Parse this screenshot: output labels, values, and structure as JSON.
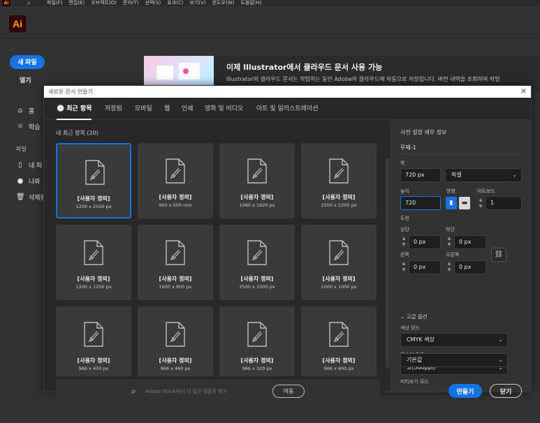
{
  "menubar": {
    "logo": "Ai",
    "items": [
      "파일(F)",
      "편집(E)",
      "오브젝트(O)",
      "문자(T)",
      "선택(S)",
      "효과(C)",
      "보기(V)",
      "윈도우(W)",
      "도움말(H)"
    ]
  },
  "header": {
    "logo": "Ai"
  },
  "home": {
    "new_file": "새 파일",
    "open": "열기",
    "home": "홈",
    "learn": "학습",
    "files_head": "파일",
    "my_files": "내 파",
    "shared": "나와",
    "deleted": "삭제됨"
  },
  "banner": {
    "title": "이제 Illustrator에서 클라우드 문서 사용 가능",
    "subtitle": "Illustrator의 클라우드 문서는 작업하는 동안 Adobe의 클라우드에 자동으로 저장됩니다. 버전 내역을 조회하여 작업"
  },
  "dialog": {
    "title": "새로운 문서 만들기",
    "tabs": [
      "최근 항목",
      "저장됨",
      "모바일",
      "웹",
      "인쇄",
      "영화 및 비디오",
      "아트 및 일러스트레이션"
    ],
    "recent_heading": "내 최근 항목 (20)",
    "presets": [
      {
        "label": "[사용자 정의]",
        "dims": "1200 x 2500 px"
      },
      {
        "label": "[사용자 정의]",
        "dims": "900 x 500 mm"
      },
      {
        "label": "[사용자 정의]",
        "dims": "1080 x 1920 px"
      },
      {
        "label": "[사용자 정의]",
        "dims": "2500 x 1200 px"
      },
      {
        "label": "[사용자 정의]",
        "dims": "1200 x 1200 px"
      },
      {
        "label": "[사용자 정의]",
        "dims": "1600 x 800 px"
      },
      {
        "label": "[사용자 정의]",
        "dims": "2500 x 1000 px"
      },
      {
        "label": "[사용자 정의]",
        "dims": "1000 x 1000 px"
      },
      {
        "label": "[사용자 정의]",
        "dims": "966 x 400 px"
      },
      {
        "label": "[사용자 정의]",
        "dims": "966 x 460 px"
      },
      {
        "label": "[사용자 정의]",
        "dims": "966 x 320 px"
      },
      {
        "label": "[사용자 정의]",
        "dims": "966 x 600 px"
      }
    ],
    "search": {
      "placeholder": "Adobe Stock에서 더 많은 템플릿 찾기",
      "go": "이동"
    },
    "details": {
      "heading": "사전 설정 세부 정보",
      "name": "무제-1",
      "width_label": "폭",
      "width": "720 px",
      "unit": "픽셀",
      "height_label": "높이",
      "height": "720",
      "orientation_label": "방향",
      "artboards_label": "아트보드",
      "artboards": "1",
      "bleed_label": "도련",
      "top_label": "상단",
      "top": "0 px",
      "bottom_label": "하단",
      "bottom": "0 px",
      "left_label": "왼쪽",
      "left": "0 px",
      "right_label": "오른쪽",
      "right": "0 px",
      "advanced": "고급 옵션",
      "color_mode_label": "색상 모드",
      "color_mode": "CMYK 색상",
      "raster_label": "래스터 효과",
      "raster": "고(300ppi)",
      "preview_label": "미리보기 모드",
      "preview": "기본값"
    },
    "create": "만들기",
    "close": "닫기"
  },
  "colors": {
    "accent": "#1473e6",
    "brand": "#ff9a00",
    "brand_bg": "#330000"
  }
}
